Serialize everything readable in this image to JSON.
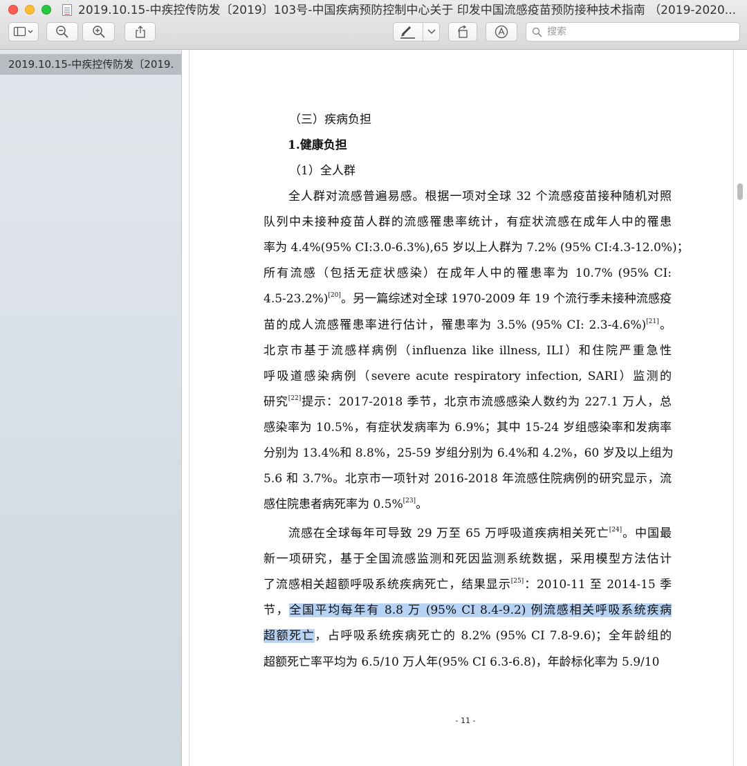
{
  "window": {
    "title": "2019.10.15-中疾控传防发〔2019〕103号-中国疾病预防控制中心关于 印发中国流感疫苗预防接种技术指南 （2019-2020..."
  },
  "toolbar": {
    "search_placeholder": "搜索",
    "icons": [
      "sidebar-toggle-icon",
      "zoom-out-icon",
      "zoom-in-icon",
      "share-icon",
      "markup-pen-icon",
      "rotate-icon",
      "annotate-icon",
      "search-icon"
    ]
  },
  "sidebar": {
    "items": [
      {
        "label": "2019.10.15-中疾控传防发〔2019..."
      }
    ]
  },
  "document": {
    "heading_section": "（三）疾病负担",
    "heading_sub": "1.健康负担",
    "heading_group": "（1）全人群",
    "p1": [
      [
        "全人群对流感普遍易感。根据一项对全球 32 个流感疫苗接种随机对照"
      ],
      [
        "队列中未接种疫苗人群的流感罹患率统计，有症状流感在成年人中的罹患"
      ],
      [
        "率为 4.4%(95% CI:3.0-6.3%),65 岁以上人群为 7.2% (95% CI:4.3-12.0%)；"
      ],
      [
        "所有流感（包括无症状感染）在成年人中的罹患率为 10.7% (95% CI:"
      ],
      [
        "4.5-23.2%)",
        "[20]",
        "。另一篇综述对全球 1970-2009 年 19 个流行季未接种流感疫"
      ],
      [
        "苗的成人流感罹患率进行估计，罹患率为 3.5% (95% CI: 2.3-4.6%)",
        "[21]",
        "。"
      ],
      [
        "北京市基于流感样病例（influenza like illness, ILI）和住院严重急性"
      ],
      [
        "呼吸道感染病例（severe acute respiratory infection, SARI）监测的"
      ],
      [
        "研究",
        "[22]",
        "提示：2017-2018 季节，北京市流感感染人数约为 227.1 万人，总"
      ],
      [
        "感染率为 10.5%，有症状发病率为 6.9%；其中 15-24 岁组感染率和发病率"
      ],
      [
        "分别为 13.4%和 8.8%，25-59 岁组分别为 6.4%和 4.2%，60 岁及以上组为"
      ],
      [
        "5.6 和 3.7%。北京市一项针对 2016-2018 年流感住院病例的研究显示，流"
      ],
      [
        "感住院患者病死率为 0.5%",
        "[23]",
        "。"
      ]
    ],
    "p2": [
      [
        "流感在全球每年可导致 29 万至 65 万呼吸道疾病相关死亡",
        "[24]",
        "。中国最"
      ],
      [
        "新一项研究，基于全国流感监测和死因监测系统数据，采用模型方法估计"
      ],
      [
        "了流感相关超额呼吸系统疾病死亡，结果显示",
        "[25]",
        "：2010-11 至 2014-15 季"
      ],
      [
        "节，",
        "全国平均每年有 8.8 万 (95% CI 8.4-9.2) 例流感相关呼吸系统疾病"
      ],
      [
        "超额死亡",
        "，占呼吸系统疾病死亡的 8.2% (95% CI 7.8-9.6)；全年龄组的"
      ],
      [
        "超额死亡率平均为 6.5/10 万人年(95% CI 6.3-6.8)，年龄标化率为 5.9/10"
      ]
    ],
    "page_number": "- 11 -"
  }
}
